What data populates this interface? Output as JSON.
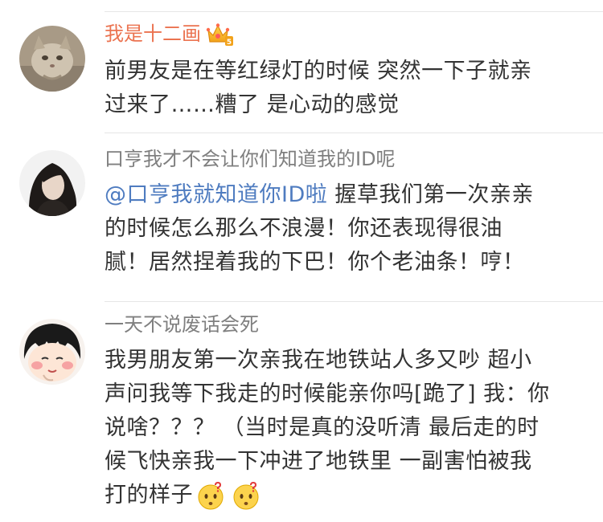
{
  "comments": [
    {
      "username": "我是十二画",
      "badge_icon": "vip-crown-icon",
      "lines": [
        "前男友是在等红绿灯的时候 突然一下子就亲",
        "过来了……糟了 是心动的感觉"
      ]
    },
    {
      "username": "口亨我才不会让你们知道我的ID呢",
      "mention": "@口亨我就知道你ID啦",
      "line1_rest": " 握草我们第一次亲亲",
      "lines": [
        "的时候怎么那么不浪漫！你还表现得很油",
        "腻！居然捏着我的下巴！你个老油条！哼！"
      ]
    },
    {
      "username": "一天不说废话会死",
      "lines": [
        "我男朋友第一次亲我在地铁站人多又吵 超小",
        "声问我等下我走的时候能亲你吗[跪了] 我：你",
        "说啥？？？ （当时是真的没听清 最后走的时",
        "候飞快亲我一下冲进了地铁里 一副害怕被我",
        "打的样子"
      ],
      "trailing_emoji": [
        "confused-face-icon",
        "confused-face-icon"
      ]
    }
  ],
  "colors": {
    "vip_name": "#eb7350",
    "normal_name": "#7f7f7f",
    "mention": "#4f7cc0",
    "text": "#333333"
  }
}
